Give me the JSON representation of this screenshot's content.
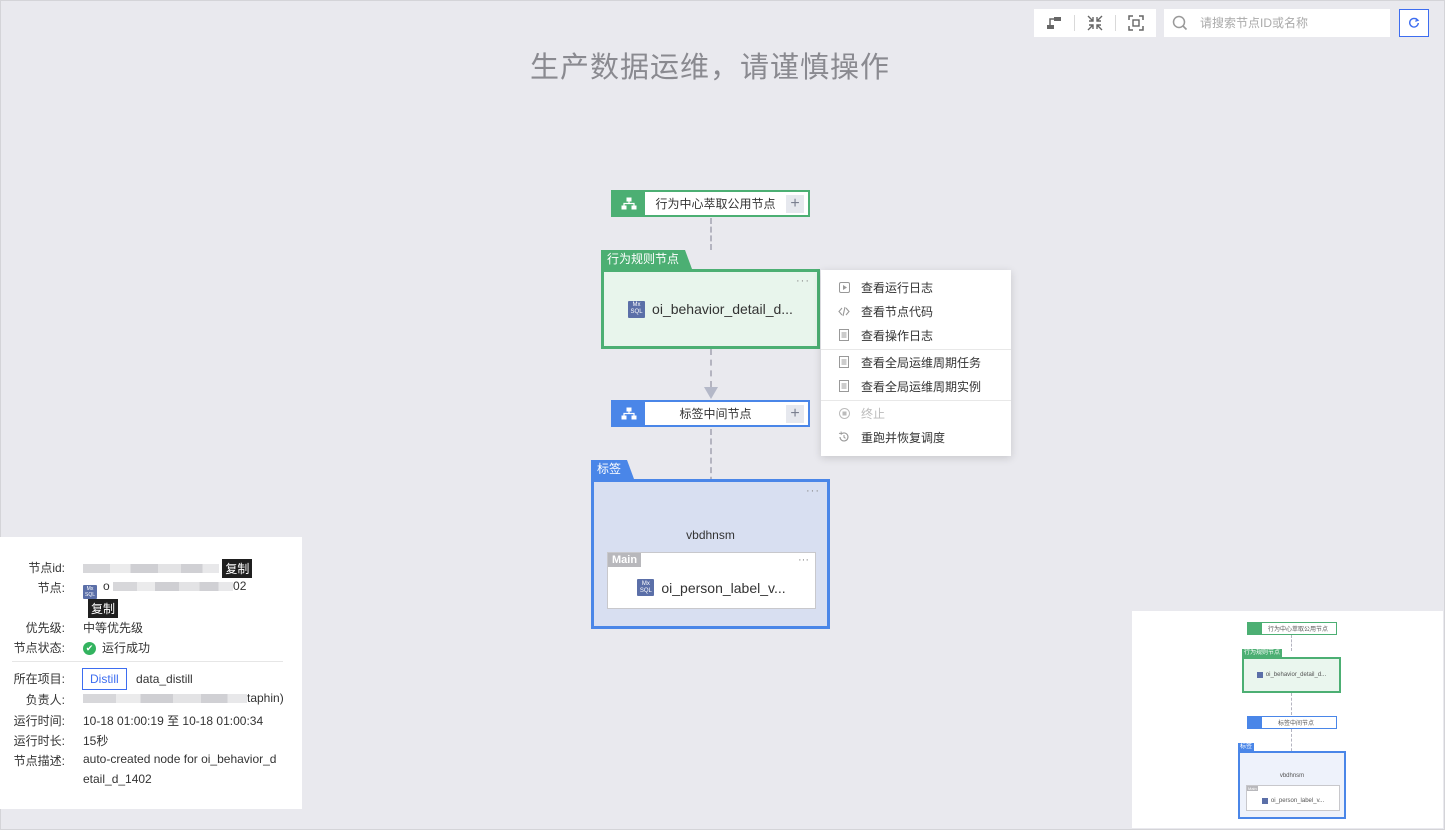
{
  "watermark": "生产数据运维，请谨慎操作",
  "search": {
    "placeholder": "请搜索节点ID或名称"
  },
  "toolbar": {
    "icons": [
      "layout-icon",
      "collapse-icon",
      "fit-view-icon",
      "refresh-icon"
    ]
  },
  "graph": {
    "node_top": {
      "label": "行为中心萃取公用节点",
      "color": "#4caf73"
    },
    "group_behavior": {
      "tab": "行为规则节点",
      "node": "oi_behavior_detail_d...",
      "color": "#4caf73"
    },
    "node_mid": {
      "label": "标签中间节点",
      "color": "#4a86e8"
    },
    "group_label": {
      "tab": "标签",
      "subtitle": "vbdhnsm",
      "inner_tab": "Main",
      "node": "oi_person_label_v...",
      "color": "#4a86e8"
    },
    "icon_text": [
      "Mx",
      "SQL"
    ]
  },
  "context_menu": {
    "items": [
      {
        "label": "查看运行日志",
        "icon": "play-icon",
        "disabled": false
      },
      {
        "label": "查看节点代码",
        "icon": "code-icon",
        "disabled": false
      },
      {
        "label": "查看操作日志",
        "icon": "document-icon",
        "disabled": false
      },
      {
        "label": "查看全局运维周期任务",
        "icon": "document-icon",
        "disabled": false
      },
      {
        "label": "查看全局运维周期实例",
        "icon": "document-icon",
        "disabled": false
      },
      {
        "label": "终止",
        "icon": "stop-icon",
        "disabled": true
      },
      {
        "label": "重跑并恢复调度",
        "icon": "rerun-icon",
        "disabled": false
      }
    ]
  },
  "info": {
    "node_id_label": "节点id:",
    "copy_label": "复制",
    "node_label": "节点:",
    "node_value_prefix": "o",
    "node_value_suffix": "02",
    "priority_label": "优先级:",
    "priority_value": "中等优先级",
    "status_label": "节点状态:",
    "status_value": "运行成功",
    "project_label": "所在项目:",
    "project_button": "Distill",
    "project_value": "data_distill",
    "owner_label": "负责人:",
    "owner_suffix": "taphin)",
    "run_time_label": "运行时间:",
    "run_time_value": "10-18 01:00:19 至 10-18 01:00:34",
    "duration_label": "运行时长:",
    "duration_value": "15秒",
    "desc_label": "节点描述:",
    "desc_line1": "auto-created node for oi_behavior_d",
    "desc_line2": "etail_d_1402"
  },
  "minimap": {
    "top_label": "行为中心萃取公用节点",
    "behavior_tab": "行为规则节点",
    "behavior_node": "oi_behavior_detail_d...",
    "mid_label": "标签中间节点",
    "label_tab": "标签",
    "label_subtitle": "vbdhnsm",
    "label_inner_tab": "Main",
    "label_node": "oi_person_label_v..."
  }
}
